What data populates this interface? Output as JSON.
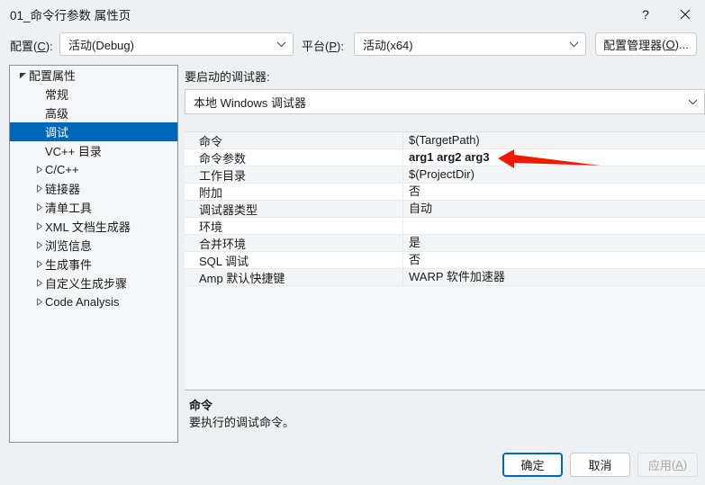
{
  "window": {
    "title": "01_命令行参数 属性页",
    "help_icon": "question-mark-icon",
    "close_icon": "close-icon"
  },
  "configbar": {
    "config_label": "配置(C):",
    "config_label_plain": "配置",
    "config_accel": "C",
    "config_value": "活动(Debug)",
    "platform_label": "平台(P):",
    "platform_label_plain": "平台",
    "platform_accel": "P",
    "platform_value": "活动(x64)",
    "config_manager_label": "配置管理器(O)...",
    "config_manager_plain": "配置管理器",
    "config_manager_accel": "O",
    "config_manager_suffix": "..."
  },
  "tree": {
    "items": [
      {
        "label": "配置属性",
        "level": 0,
        "glyph": "expanded-triangle",
        "selected": false
      },
      {
        "label": "常规",
        "level": 1,
        "glyph": "none",
        "selected": false
      },
      {
        "label": "高级",
        "level": 1,
        "glyph": "none",
        "selected": false
      },
      {
        "label": "调试",
        "level": 1,
        "glyph": "none",
        "selected": true
      },
      {
        "label": "VC++ 目录",
        "level": 1,
        "glyph": "none",
        "selected": false
      },
      {
        "label": "C/C++",
        "level": 1,
        "glyph": "collapsed-triangle",
        "selected": false
      },
      {
        "label": "链接器",
        "level": 1,
        "glyph": "collapsed-triangle",
        "selected": false
      },
      {
        "label": "清单工具",
        "level": 1,
        "glyph": "collapsed-triangle",
        "selected": false
      },
      {
        "label": "XML 文档生成器",
        "level": 1,
        "glyph": "collapsed-triangle",
        "selected": false
      },
      {
        "label": "浏览信息",
        "level": 1,
        "glyph": "collapsed-triangle",
        "selected": false
      },
      {
        "label": "生成事件",
        "level": 1,
        "glyph": "collapsed-triangle",
        "selected": false
      },
      {
        "label": "自定义生成步骤",
        "level": 1,
        "glyph": "collapsed-triangle",
        "selected": false
      },
      {
        "label": "Code Analysis",
        "level": 1,
        "glyph": "collapsed-triangle",
        "selected": false
      }
    ]
  },
  "main": {
    "debugger_caption": "要启动的调试器:",
    "debugger_value": "本地 Windows 调试器",
    "grid": {
      "rows": [
        {
          "name": "命令",
          "value": "$(TargetPath)",
          "bold": false
        },
        {
          "name": "命令参数",
          "value": "arg1 arg2 arg3",
          "bold": true
        },
        {
          "name": "工作目录",
          "value": "$(ProjectDir)",
          "bold": false
        },
        {
          "name": "附加",
          "value": "否",
          "bold": false
        },
        {
          "name": "调试器类型",
          "value": "自动",
          "bold": false
        },
        {
          "name": "环境",
          "value": "",
          "bold": false
        },
        {
          "name": "合并环境",
          "value": "是",
          "bold": false
        },
        {
          "name": "SQL 调试",
          "value": "否",
          "bold": false
        },
        {
          "name": "Amp 默认快捷键",
          "value": "WARP 软件加速器",
          "bold": false
        }
      ]
    },
    "description": {
      "title": "命令",
      "body": "要执行的调试命令。"
    }
  },
  "footer": {
    "ok_label": "确定",
    "cancel_label": "取消",
    "apply_label": "应用(A)",
    "apply_plain": "应用",
    "apply_accel": "A"
  },
  "annotation": {
    "arrow_color": "#f51800",
    "arrow_direction": "left"
  },
  "colors": {
    "selection_blue": "#0067b8",
    "focus_blue": "#0067b8",
    "dialog_bg": "#eef0f1",
    "panel_bg": "#f5f6f7",
    "grid_row_bg": "#ffffff",
    "grid_row_alt_bg": "#f3f4f6"
  }
}
